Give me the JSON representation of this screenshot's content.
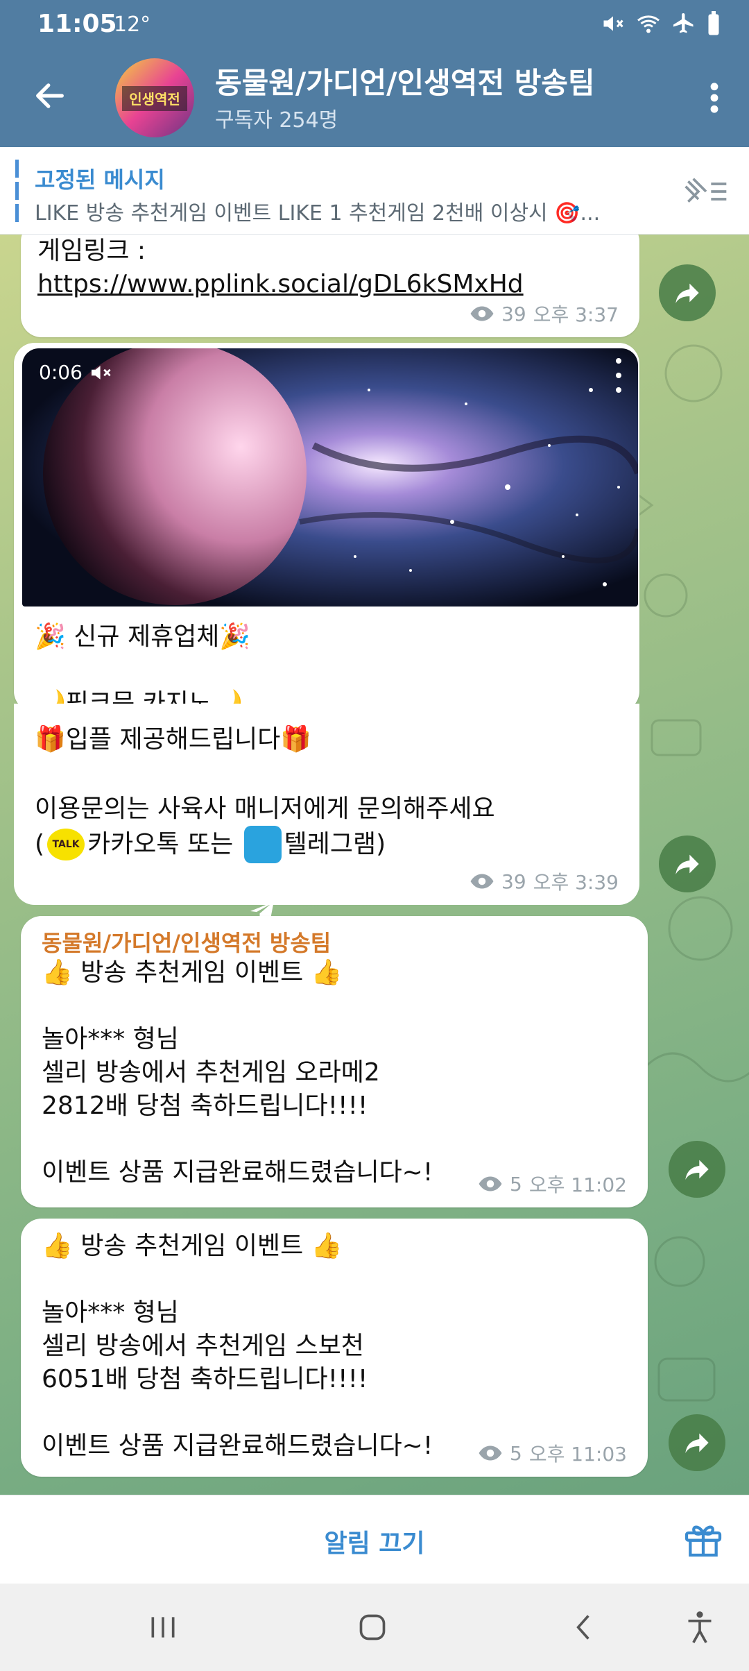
{
  "status_bar": {
    "time": "11:05",
    "temperature": "12°"
  },
  "header": {
    "title": "동물원/가디언/인생역전 방송팀",
    "subscribers": "구독자 254명",
    "avatar_text": "인생역전"
  },
  "pinned": {
    "label": "고정된 메시지",
    "preview": "LIKE 방송 추천게임 이벤트 LIKE  1 추천게임 2천배 이상시 🎯..."
  },
  "messages": [
    {
      "text": "게임링크 :",
      "link": "https://www.pplink.social/gDL6kSMxHd",
      "views": "39",
      "time": "오후 3:37"
    },
    {
      "video_time": "0:06",
      "line1": "🎉 신규 제휴업체🎉",
      "line2": "🌙핑크문 카지노🌙",
      "line3": "🎁입플 제공해드립니다🎁",
      "line4": "이용문의는 사육사 매니저에게 문의해주세요",
      "line5_pre": "(",
      "kakao_badge": "TALK",
      "line5_mid": "카카오톡 또는 ",
      "line5_post": "텔레그램)",
      "views": "39",
      "time": "오후 3:39"
    },
    {
      "sender": "동물원/가디언/인생역전 방송팀",
      "text": "👍 방송 추천게임 이벤트 👍\n\n놀아*** 형님\n셀리 방송에서 추천게임 오라메2\n2812배 당첨 축하드립니다!!!!\n\n이벤트 상품 지급완료해드렸습니다~!",
      "views": "5",
      "time": "오후 11:02"
    },
    {
      "text": "👍 방송 추천게임 이벤트 👍\n\n놀아*** 형님\n셀리 방송에서 추천게임 스보천\n6051배 당첨 축하드립니다!!!!\n\n이벤트 상품 지급완료해드렸습니다~!",
      "views": "5",
      "time": "오후 11:03"
    }
  ],
  "bottom_bar": {
    "mute_label": "알림 끄기"
  },
  "colors": {
    "header": "#517da2",
    "accent": "#3a8bd0",
    "sender": "#d4792a"
  }
}
